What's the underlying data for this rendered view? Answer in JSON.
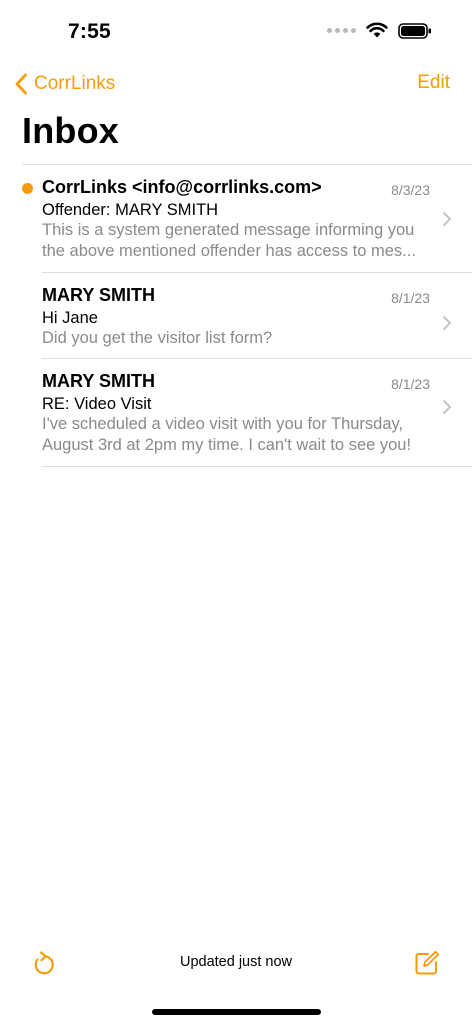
{
  "status_bar": {
    "time": "7:55"
  },
  "nav": {
    "back_label": "CorrLinks",
    "edit_label": "Edit"
  },
  "page": {
    "title": "Inbox"
  },
  "messages": [
    {
      "sender": "CorrLinks <info@corrlinks.com>",
      "date": "8/3/23",
      "subject": "Offender: MARY SMITH",
      "preview_line1": "This is a system generated message informing you",
      "preview_line2": "the above mentioned offender has access to mes...",
      "unread": true
    },
    {
      "sender": "MARY SMITH",
      "date": "8/1/23",
      "subject": "Hi Jane",
      "preview_line1": "Did you get the visitor list form?",
      "preview_line2": "",
      "unread": false
    },
    {
      "sender": "MARY SMITH",
      "date": "8/1/23",
      "subject": "RE: Video Visit",
      "preview_line1": "I've scheduled a video visit with you for Thursday,",
      "preview_line2": "August 3rd at 2pm my time. I can't wait to see you!",
      "unread": false
    }
  ],
  "toolbar": {
    "status_text": "Updated just now",
    "refresh_icon": "refresh-icon",
    "compose_icon": "compose-icon"
  },
  "colors": {
    "accent": "#f59c0c",
    "secondary_text": "#8a8a8e",
    "divider": "#dcdcdc"
  }
}
